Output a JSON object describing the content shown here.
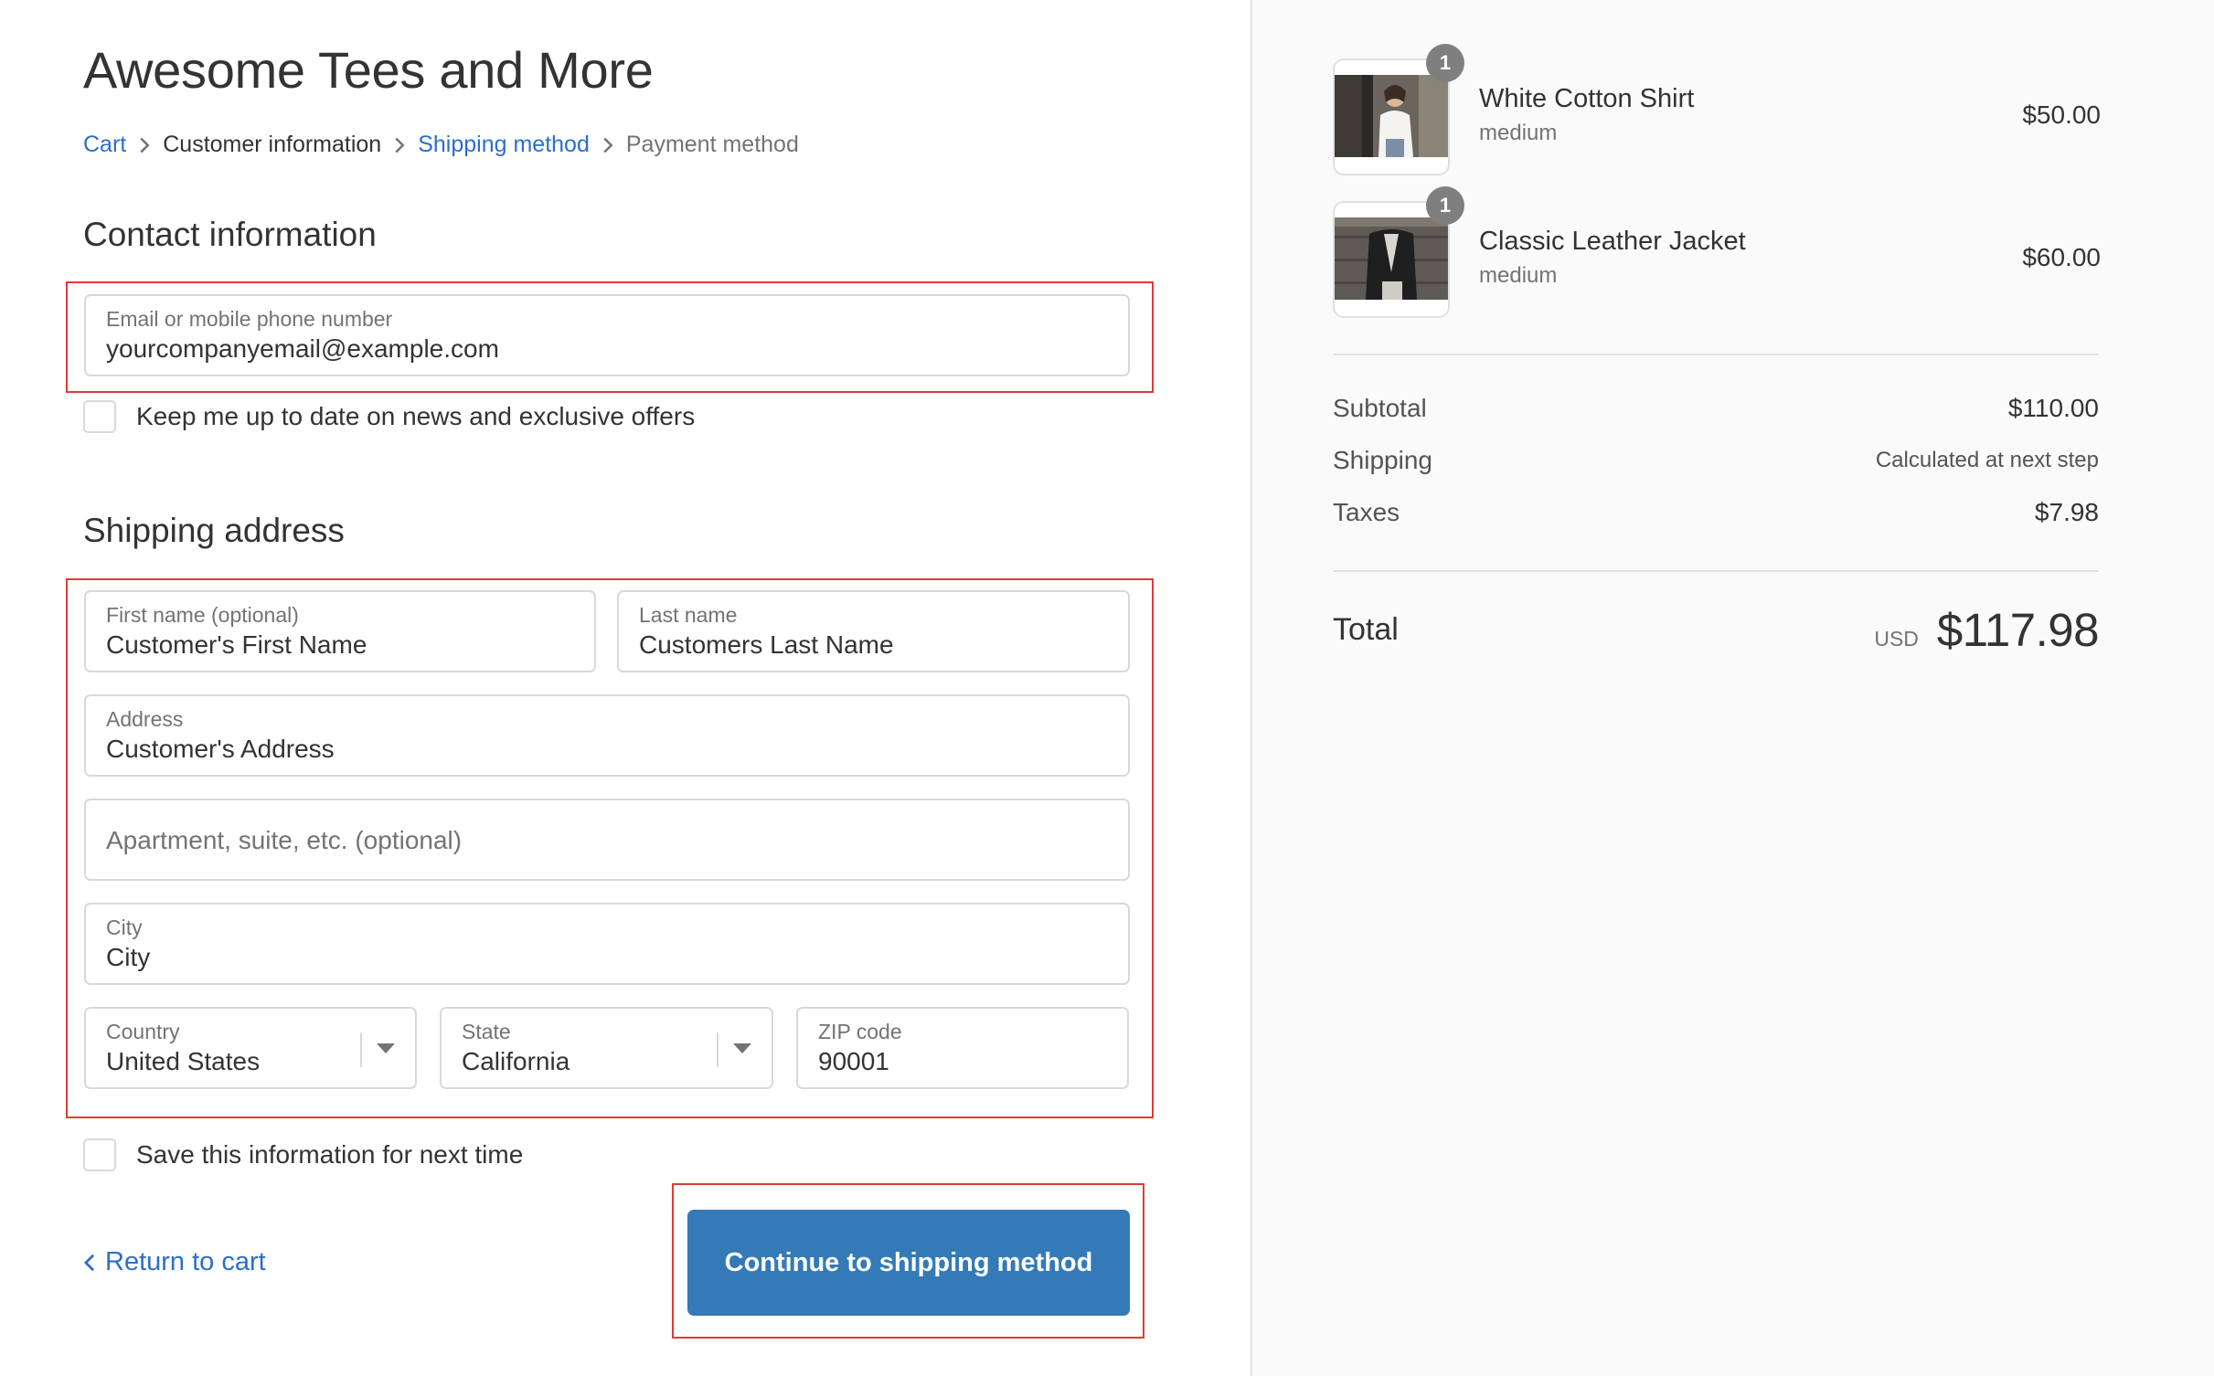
{
  "shop": {
    "title": "Awesome Tees and More"
  },
  "breadcrumb": {
    "cart": "Cart",
    "customer_information": "Customer information",
    "shipping_method": "Shipping method",
    "payment_method": "Payment method"
  },
  "contact": {
    "title": "Contact information",
    "email_label": "Email or mobile phone number",
    "email_value": "yourcompanyemail@example.com",
    "newsletter_label": "Keep me up to date on news and exclusive offers"
  },
  "shipping": {
    "title": "Shipping address",
    "first_name_label": "First name (optional)",
    "first_name_value": "Customer's First Name",
    "last_name_label": "Last name",
    "last_name_value": "Customers Last Name",
    "address_label": "Address",
    "address_value": "Customer's Address",
    "apartment_placeholder": "Apartment, suite, etc. (optional)",
    "city_label": "City",
    "city_value": "City",
    "country_label": "Country",
    "country_value": "United States",
    "state_label": "State",
    "state_value": "California",
    "zip_label": "ZIP code",
    "zip_value": "90001",
    "save_label": "Save this information for next time"
  },
  "actions": {
    "return_label": "Return to cart",
    "continue_label": "Continue to shipping method"
  },
  "order": {
    "items": [
      {
        "name": "White Cotton Shirt",
        "variant": "medium",
        "price": "$50.00",
        "qty": "1"
      },
      {
        "name": "Classic Leather Jacket",
        "variant": "medium",
        "price": "$60.00",
        "qty": "1"
      }
    ],
    "subtotal_label": "Subtotal",
    "subtotal_value": "$110.00",
    "shipping_label": "Shipping",
    "shipping_value": "Calculated at next step",
    "taxes_label": "Taxes",
    "taxes_value": "$7.98",
    "total_label": "Total",
    "currency": "USD",
    "total_value": "$117.98"
  },
  "colors": {
    "link": "#2c6ecb",
    "button": "#337ab7",
    "highlight": "#e53935"
  }
}
